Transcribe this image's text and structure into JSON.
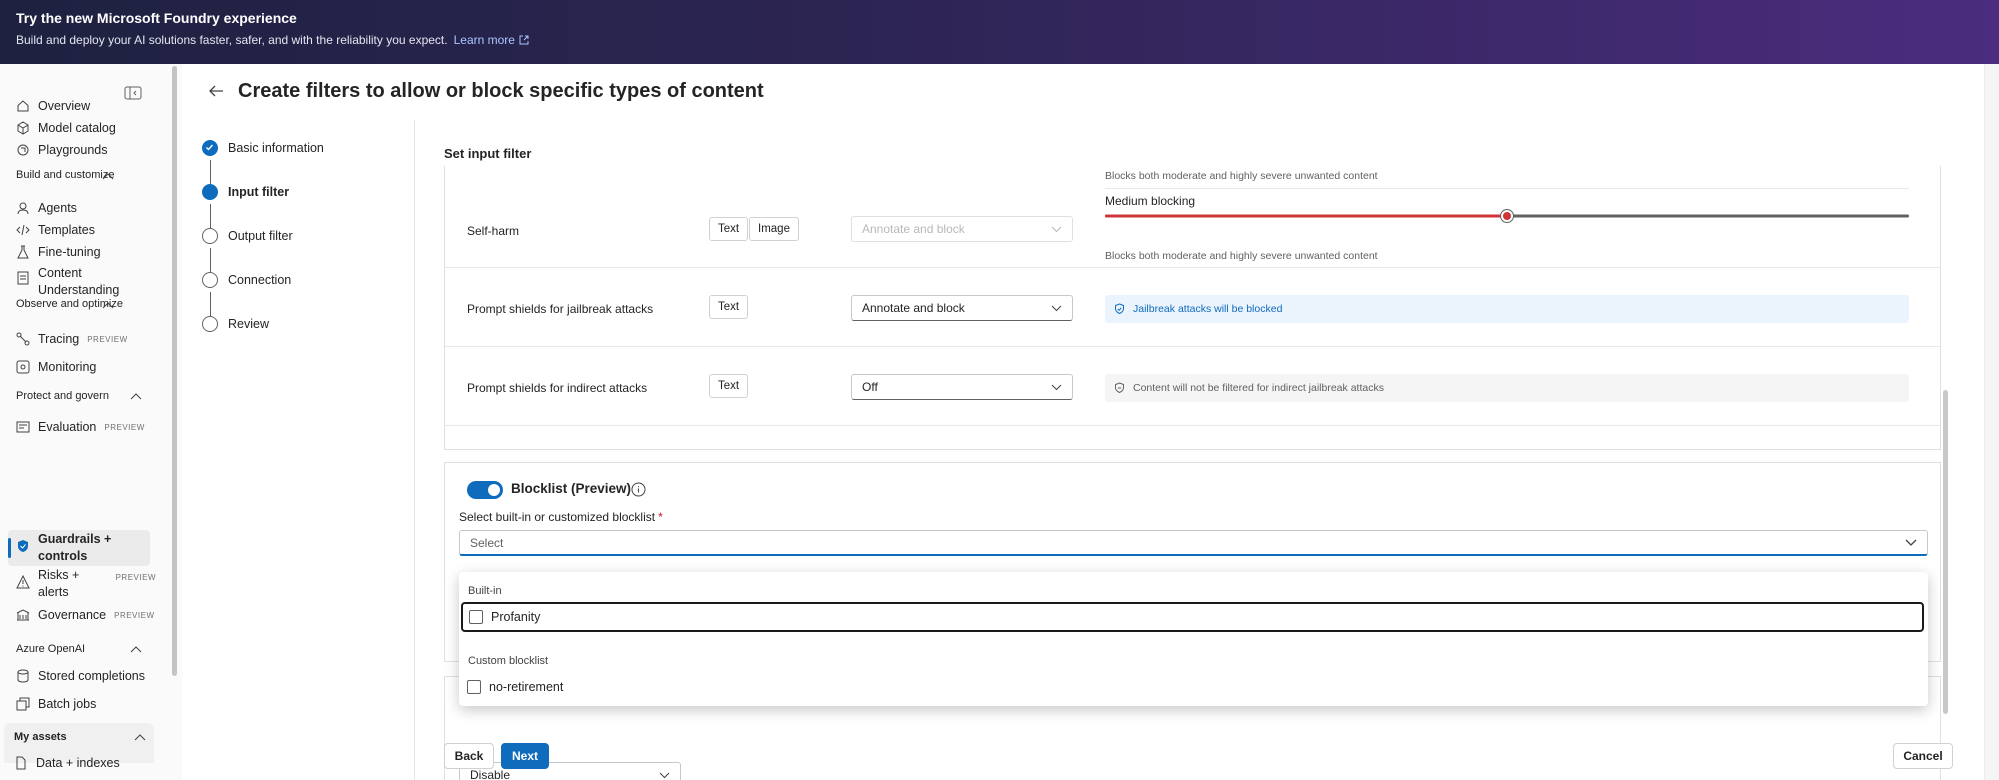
{
  "banner": {
    "title": "Try the new Microsoft Foundry experience",
    "subtitle": "Build and deploy your AI solutions faster, safer, and with the reliability you expect.",
    "link": "Learn more"
  },
  "sidebar": {
    "items": {
      "overview": "Overview",
      "model_catalog": "Model catalog",
      "playgrounds": "Playgrounds",
      "agents": "Agents",
      "templates": "Templates",
      "fine_tuning": "Fine-tuning",
      "content_understanding": "Content Understanding",
      "tracing": "Tracing",
      "monitoring": "Monitoring",
      "evaluation": "Evaluation",
      "guardrails": "Guardrails + controls",
      "risks": "Risks + alerts",
      "governance": "Governance",
      "stored_completions": "Stored completions",
      "batch_jobs": "Batch jobs",
      "data_indexes": "Data + indexes"
    },
    "sections": {
      "build": "Build and customize",
      "observe": "Observe and optimize",
      "protect": "Protect and govern",
      "azure_openai": "Azure OpenAI",
      "my_assets": "My assets"
    },
    "badge": "PREVIEW"
  },
  "page": {
    "title": "Create filters to allow or block specific types of content"
  },
  "stepper": {
    "steps": [
      "Basic information",
      "Input filter",
      "Output filter",
      "Connection",
      "Review"
    ],
    "active_index": 1
  },
  "input_filter": {
    "section_title": "Set input filter",
    "top_note": "Blocks both moderate and highly severe unwanted content",
    "self_harm": {
      "name": "Self-harm",
      "chips": [
        "Text",
        "Image"
      ],
      "action": "Annotate and block",
      "level_label": "Medium blocking",
      "level_value": 0.5,
      "note": "Blocks both moderate and highly severe unwanted content"
    },
    "jailbreak": {
      "name": "Prompt shields for jailbreak attacks",
      "chip": "Text",
      "action": "Annotate and block",
      "info": "Jailbreak attacks will be blocked"
    },
    "indirect": {
      "name": "Prompt shields for indirect attacks",
      "chip": "Text",
      "action": "Off",
      "info": "Content will not be filtered for indirect jailbreak attacks"
    }
  },
  "blocklist": {
    "title": "Blocklist (Preview)",
    "enabled": true,
    "select_label": "Select built-in or customized blocklist",
    "required_mark": "*",
    "placeholder": "Select",
    "groups": [
      {
        "label": "Built-in",
        "options": [
          "Profanity"
        ]
      },
      {
        "label": "Custom blocklist",
        "options": [
          "no-retirement"
        ]
      }
    ],
    "behind_dropdown": "Disable"
  },
  "footer": {
    "back": "Back",
    "next": "Next",
    "cancel": "Cancel"
  },
  "colors": {
    "accent": "#0f6cbd",
    "slider_active": "#d13438",
    "banner_start": "#1e2140",
    "banner_end": "#4b2c7e"
  }
}
